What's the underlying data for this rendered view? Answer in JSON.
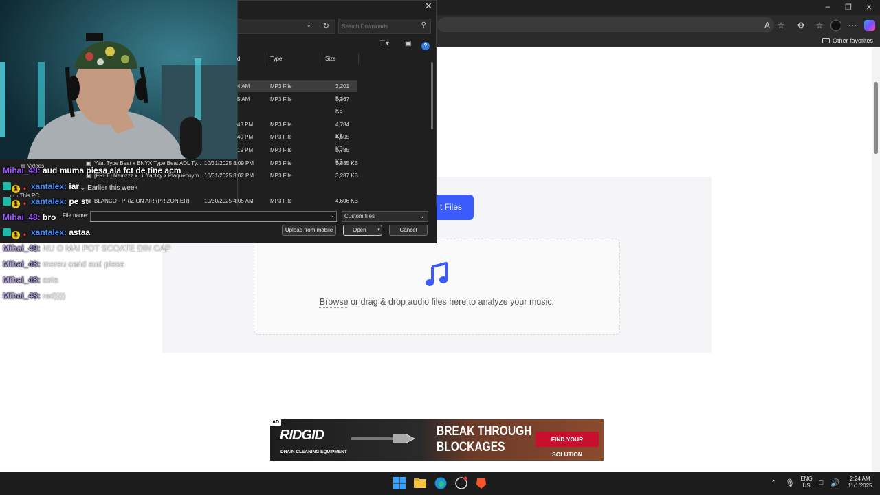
{
  "browser": {
    "favorites_label": "Other favorites",
    "title_buttons": [
      "─",
      "❐",
      "✕"
    ]
  },
  "page": {
    "select_files_label": "t Files",
    "drop_browse": "Browse",
    "drop_text": " or drag & drop audio files here to analyze your music."
  },
  "ad": {
    "tag": "AD",
    "brand": "RIDGID",
    "sub": "DRAIN CLEANING EQUIPMENT",
    "headline_1": "BREAK THROUGH",
    "headline_2": "BLOCKAGES",
    "cta": "FIND YOUR SOLUTION"
  },
  "dialog": {
    "search_placeholder": "Search Downloads",
    "columns": {
      "date_tail": "d",
      "type": "Type",
      "size": "Size"
    },
    "rows": [
      {
        "time": "4 AM",
        "type": "MP3 File",
        "size": "3,201 KB",
        "selected": true
      },
      {
        "time": "5 AM",
        "type": "MP3 File",
        "size": "3,367 KB"
      },
      {
        "time": "43 PM",
        "type": "MP3 File",
        "size": "4,784 KB"
      },
      {
        "time": "40 PM",
        "type": "MP3 File",
        "size": "4,505 KB"
      },
      {
        "time": "19 PM",
        "type": "MP3 File",
        "size": "3,785 KB"
      }
    ],
    "full_rows": [
      {
        "name": "Yeat Type Beat x BNYX Type Beat  ADL Ty...",
        "date": "10/31/2025 8:09 PM",
        "type": "MP3 File",
        "size": "3,885 KB"
      },
      {
        "name": "[FREE] Nemzzz x Lil Yachty x Plaqueboym...",
        "date": "10/31/2025 8:02 PM",
        "type": "MP3 File",
        "size": "3,287 KB"
      },
      {
        "name": "BLANCO - PRIZ ON AIR (PRIZONIER)",
        "date": "10/30/2025 4:05 AM",
        "type": "MP3 File",
        "size": "4,606 KB"
      }
    ],
    "group_label": "Earlier this week",
    "nav_videos": "Videos",
    "nav_thispc": "This PC",
    "file_name_label": "File name:",
    "file_name_value": "",
    "file_type": "Custom files",
    "upload_mobile": "Upload from mobile",
    "open": "Open",
    "cancel": "Cancel"
  },
  "chat": [
    {
      "user": "Mihai_48",
      "kind": "m",
      "msg": "aud muma piesa aia fct de tine acm"
    },
    {
      "user": "xantalex",
      "kind": "x",
      "msg": "iar"
    },
    {
      "user": "xantalex",
      "kind": "x",
      "msg": "pe st"
    },
    {
      "user": "Mihai_48",
      "kind": "m",
      "msg": "bro"
    },
    {
      "user": "xantalex",
      "kind": "x",
      "msg": "astaa"
    },
    {
      "user": "Mihai_48",
      "kind": "m",
      "msg": "NU O MAI POT SCOATE DIN CAP",
      "faded": true
    },
    {
      "user": "Mihai_48",
      "kind": "m",
      "msg": "mereu cand aud piesa",
      "faded": true
    },
    {
      "user": "Mihai_48",
      "kind": "m",
      "msg": "asta",
      "faded": true
    },
    {
      "user": "Mihai_48",
      "kind": "m",
      "msg": "rad))))",
      "faded": true
    }
  ],
  "chat_sep": ":",
  "badge_num": "1",
  "taskbar": {
    "lang_1": "ENG",
    "lang_2": "US",
    "time": "2:24 AM",
    "date": "11/1/2025"
  },
  "colors": {
    "accent": "#3b5bfd",
    "music_icon": "#3b5bfd",
    "chat_user_mihai": "#9b59ff",
    "chat_user_xantalex": "#3b8bff"
  }
}
